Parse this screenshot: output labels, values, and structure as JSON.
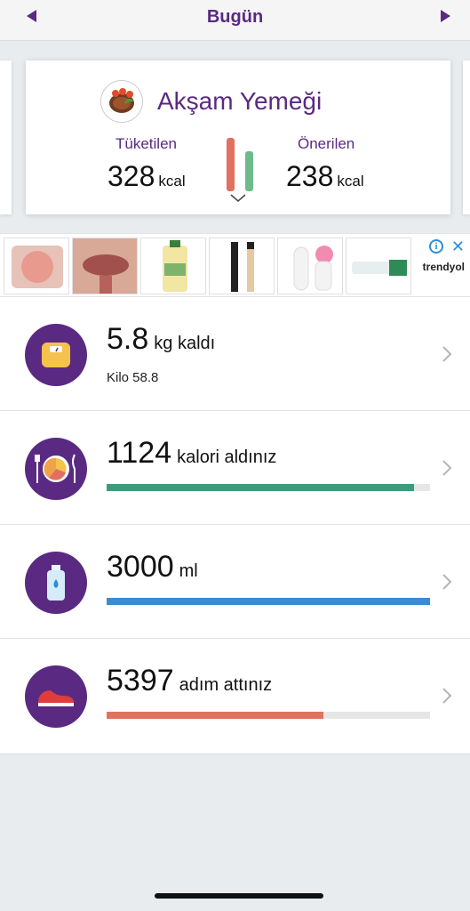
{
  "header": {
    "title": "Bugün"
  },
  "meal": {
    "title": "Akşam Yemeği",
    "consumed_label": "Tüketilen",
    "consumed_value": "328",
    "suggested_label": "Önerilen",
    "suggested_value": "238",
    "unit": "kcal"
  },
  "ad": {
    "brand": "trendyol",
    "info_symbol": "i",
    "close_symbol": "✕"
  },
  "stats": {
    "weight": {
      "value": "5.8",
      "suffix": "kg kaldı",
      "sub": "Kilo 58.8"
    },
    "calories": {
      "value": "1124",
      "suffix": "kalori aldınız",
      "progress": 0.95,
      "color": "#3f9a7d"
    },
    "water": {
      "value": "3000",
      "suffix": "ml",
      "progress": 1.0,
      "color": "#3b8bd3"
    },
    "steps": {
      "value": "5397",
      "suffix": "adım attınız",
      "progress": 0.67,
      "color": "#e0735f"
    }
  },
  "colors": {
    "brand": "#5a2a82",
    "consumed_bar": "#e07060",
    "suggested_bar": "#6dbb8a"
  }
}
